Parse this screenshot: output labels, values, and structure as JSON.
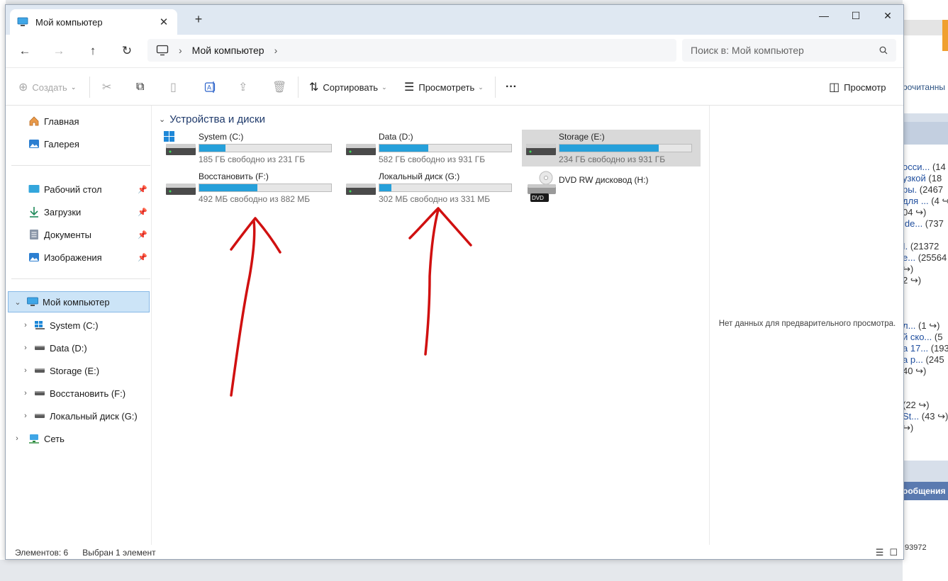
{
  "background": {
    "right_partial_text": "рочитанны",
    "right_lines": [
      {
        "link": "осси...",
        "rest": " (14"
      },
      {
        "link": "узкой",
        "rest": " (18"
      },
      {
        "link": "ры.",
        "rest": " (2467"
      },
      {
        "link": "для ...",
        "rest": " (4 ↪"
      },
      {
        "link": "",
        "rest": "04 ↪)"
      },
      {
        "link": "ide...",
        "rest": " (737"
      },
      {
        "link": "I.",
        "rest": " (21372"
      },
      {
        "link": "e...",
        "rest": " (25564"
      },
      {
        "link": "",
        "rest": "↪)"
      },
      {
        "link": "",
        "rest": "2 ↪)"
      },
      {
        "link": "л...",
        "rest": " (1 ↪)"
      },
      {
        "link": "й ско...",
        "rest": " (5"
      },
      {
        "link": "а 17...",
        "rest": " (193"
      },
      {
        "link": "а р...",
        "rest": " (245"
      },
      {
        "link": "",
        "rest": "40 ↪)"
      },
      {
        "link": "",
        "rest": "(22 ↪)"
      },
      {
        "link": "St...",
        "rest": " (43 ↪)"
      },
      {
        "link": "",
        "rest": "↪)"
      }
    ],
    "messages_label": "ообщения",
    "number": ".93972"
  },
  "window": {
    "tab_title": "Мой компьютер",
    "new_tab": "+",
    "controls": {
      "minimize": "—",
      "maximize": "☐",
      "close": "✕"
    }
  },
  "nav": {
    "back": "←",
    "forward": "→",
    "up": "↑",
    "refresh": "↻",
    "breadcrumb": "Мой компьютер",
    "search_placeholder": "Поиск в: Мой компьютер"
  },
  "toolbar": {
    "create": "Создать",
    "sort": "Сортировать",
    "view": "Просмотреть",
    "more": "···",
    "preview": "Просмотр"
  },
  "sidebar": {
    "home": "Главная",
    "gallery": "Галерея",
    "quick": [
      {
        "label": "Рабочий стол"
      },
      {
        "label": "Загрузки"
      },
      {
        "label": "Документы"
      },
      {
        "label": "Изображения"
      }
    ],
    "this_pc": "Мой компьютер",
    "drives": [
      {
        "label": "System (C:)"
      },
      {
        "label": "Data (D:)"
      },
      {
        "label": "Storage (E:)"
      },
      {
        "label": "Восстановить (F:)"
      },
      {
        "label": "Локальный диск (G:)"
      }
    ],
    "network": "Сеть"
  },
  "main": {
    "group_title": "Устройства и диски",
    "drives": [
      {
        "name": "System (C:)",
        "free": "185 ГБ свободно из 231 ГБ",
        "used_fraction": 0.2,
        "icon": "windows-drive"
      },
      {
        "name": "Data (D:)",
        "free": "582 ГБ свободно из 931 ГБ",
        "used_fraction": 0.37,
        "icon": "drive"
      },
      {
        "name": "Storage (E:)",
        "free": "234 ГБ свободно из 931 ГБ",
        "used_fraction": 0.75,
        "icon": "drive"
      },
      {
        "name": "Восстановить (F:)",
        "free": "492 МБ свободно из 882 МБ",
        "used_fraction": 0.44,
        "icon": "drive"
      },
      {
        "name": "Локальный диск (G:)",
        "free": "302 МБ свободно из 331 МБ",
        "used_fraction": 0.09,
        "icon": "drive"
      }
    ],
    "dvd": {
      "name": "DVD RW дисковод (H:)",
      "badge": "DVD"
    }
  },
  "preview_pane": {
    "message": "Нет данных для предварительного просмотра."
  },
  "status": {
    "count": "Элементов: 6",
    "selected": "Выбран 1 элемент"
  },
  "colors": {
    "bar_fill": "#26a0da",
    "selection": "#cce4f7",
    "annotation": "#d01010"
  }
}
